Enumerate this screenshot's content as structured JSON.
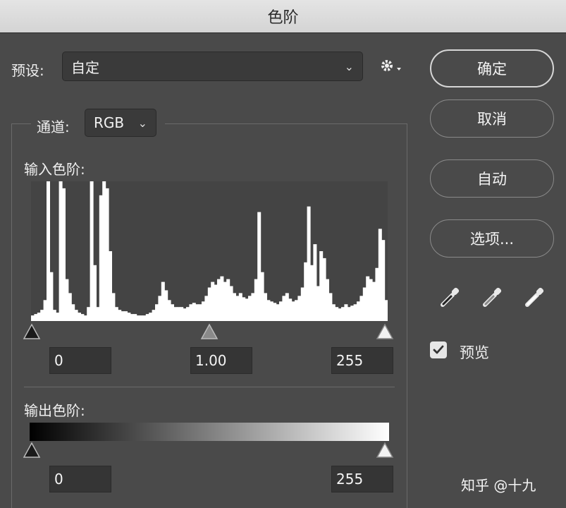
{
  "window": {
    "title": "色阶"
  },
  "preset": {
    "label": "预设:",
    "value": "自定"
  },
  "channel": {
    "label": "通道:",
    "value": "RGB"
  },
  "input_levels": {
    "label": "输入色阶:",
    "black": "0",
    "gamma": "1.00",
    "white": "255"
  },
  "output_levels": {
    "label": "输出色阶:",
    "black": "0",
    "white": "255"
  },
  "buttons": {
    "ok": "确定",
    "cancel": "取消",
    "auto": "自动",
    "options": "选项..."
  },
  "preview": {
    "label": "预览",
    "checked": true
  },
  "watermark": "知乎 @十九",
  "histogram": {
    "levels": [
      0.04,
      0.05,
      0.06,
      0.08,
      0.15,
      1.0,
      0.35,
      0.08,
      0.06,
      1.0,
      0.95,
      0.3,
      0.2,
      0.12,
      0.08,
      0.06,
      0.05,
      0.04,
      0.1,
      1.0,
      0.4,
      0.1,
      0.9,
      1.0,
      0.95,
      0.5,
      0.2,
      0.1,
      0.08,
      0.07,
      0.07,
      0.06,
      0.05,
      0.05,
      0.04,
      0.04,
      0.04,
      0.05,
      0.06,
      0.08,
      0.12,
      0.18,
      0.28,
      0.22,
      0.15,
      0.12,
      0.1,
      0.1,
      0.1,
      0.09,
      0.1,
      0.12,
      0.13,
      0.12,
      0.12,
      0.14,
      0.18,
      0.24,
      0.28,
      0.26,
      0.3,
      0.32,
      0.28,
      0.3,
      0.25,
      0.2,
      0.18,
      0.2,
      0.17,
      0.16,
      0.18,
      0.2,
      0.3,
      0.78,
      0.35,
      0.2,
      0.15,
      0.14,
      0.13,
      0.12,
      0.14,
      0.18,
      0.2,
      0.16,
      0.14,
      0.15,
      0.18,
      0.24,
      0.42,
      0.82,
      0.4,
      0.55,
      0.25,
      0.5,
      0.45,
      0.3,
      0.2,
      0.12,
      0.1,
      0.09,
      0.1,
      0.12,
      0.1,
      0.11,
      0.12,
      0.14,
      0.18,
      0.24,
      0.32,
      0.3,
      0.28,
      0.38,
      0.66,
      0.58,
      0.15
    ]
  },
  "colors": {
    "background": "#4a4a4a",
    "titlebar": "#d8d8d8",
    "histogram_bg": "#444444",
    "histogram_fg": "#ffffff"
  }
}
